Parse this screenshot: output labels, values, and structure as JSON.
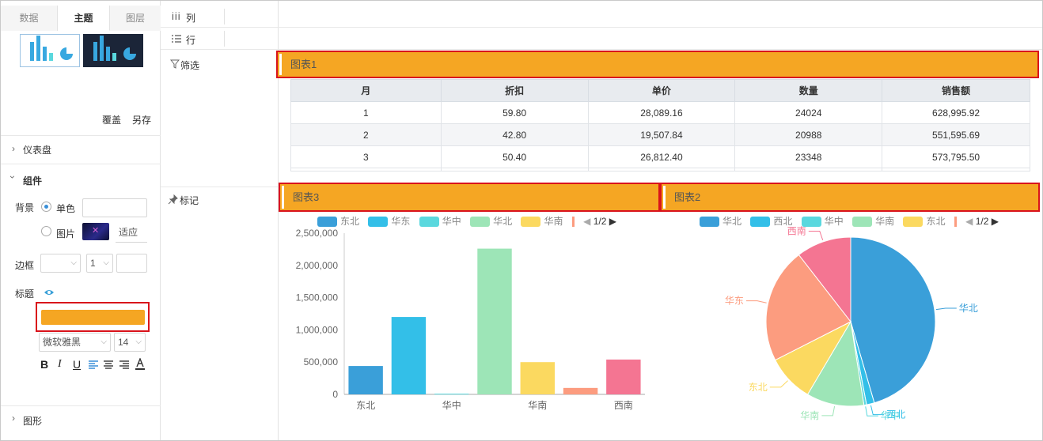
{
  "left_panel": {
    "tabs": [
      "数据",
      "主题",
      "图层"
    ],
    "active_tab": "主题",
    "actions": {
      "overwrite": "覆盖",
      "save_as": "另存"
    },
    "dashboard_section": "仪表盘",
    "component_section": "组件",
    "background": {
      "label": "背景",
      "option_solid": "单色",
      "option_image": "图片",
      "fit": "适应"
    },
    "border": {
      "label": "边框",
      "width": "1"
    },
    "title": {
      "label": "标题",
      "color": "#f5a623",
      "font": "微软雅黑",
      "size": "14"
    },
    "format_buttons": [
      "B",
      "I",
      "U"
    ],
    "graphic_section": "图形"
  },
  "middle": {
    "columns_label": "列",
    "rows_label": "行",
    "filter_label": "筛选",
    "mark_label": "标记"
  },
  "chart1": {
    "title": "图表1",
    "headers": [
      "月",
      "折扣",
      "单价",
      "数量",
      "销售额"
    ],
    "rows": [
      [
        "1",
        "59.80",
        "28,089.16",
        "24024",
        "628,995.92"
      ],
      [
        "2",
        "42.80",
        "19,507.84",
        "20988",
        "551,595.69"
      ],
      [
        "3",
        "50.40",
        "26,812.40",
        "23348",
        "573,795.50"
      ]
    ]
  },
  "chart3": {
    "title": "图表3",
    "legend": [
      "东北",
      "华东",
      "华中",
      "华北",
      "华南"
    ],
    "legend_page": "1/2"
  },
  "chart2": {
    "title": "图表2",
    "legend": [
      "华北",
      "西北",
      "华中",
      "华南",
      "东北"
    ],
    "legend_page": "1/2"
  },
  "colors": {
    "accent": "#f5a623",
    "highlight": "#d9131b"
  },
  "chart_data": [
    {
      "type": "bar",
      "title": "图表3",
      "categories": [
        "东北",
        "华东",
        "华中",
        "华北",
        "华南",
        "西南?",
        "西南"
      ],
      "x_tick_labels": [
        "东北",
        "华中",
        "华南",
        "西南"
      ],
      "y_tick_labels": [
        "2,500,000",
        "2,000,000",
        "1,500,000",
        "1,000,000",
        "500,000",
        "0"
      ],
      "bars": [
        {
          "name": "东北",
          "value": 440000,
          "color": "#3a9fd9"
        },
        {
          "name": "华东",
          "value": 1200000,
          "color": "#33bfe8"
        },
        {
          "name": "华中",
          "value": 10000,
          "color": "#5ad8de"
        },
        {
          "name": "华北",
          "value": 2260000,
          "color": "#9de5b7"
        },
        {
          "name": "华南",
          "value": 500000,
          "color": "#fbd960"
        },
        {
          "name": "",
          "value": 100000,
          "color": "#fc9c7f"
        },
        {
          "name": "西南",
          "value": 540000,
          "color": "#f47592"
        }
      ],
      "ylim": [
        0,
        2500000
      ],
      "grid": false
    },
    {
      "type": "pie",
      "title": "图表2",
      "slices": [
        {
          "name": "华北",
          "value": 45.5,
          "color": "#3a9fd9"
        },
        {
          "name": "西北",
          "value": 1.5,
          "color": "#33bfe8"
        },
        {
          "name": "华中",
          "value": 0.5,
          "color": "#5ad8de"
        },
        {
          "name": "华南",
          "value": 11,
          "color": "#9de5b7"
        },
        {
          "name": "东北",
          "value": 9,
          "color": "#fbd960"
        },
        {
          "name": "华东",
          "value": 22,
          "color": "#fc9c7f"
        },
        {
          "name": "西南",
          "value": 10.5,
          "color": "#f47592"
        }
      ]
    }
  ]
}
